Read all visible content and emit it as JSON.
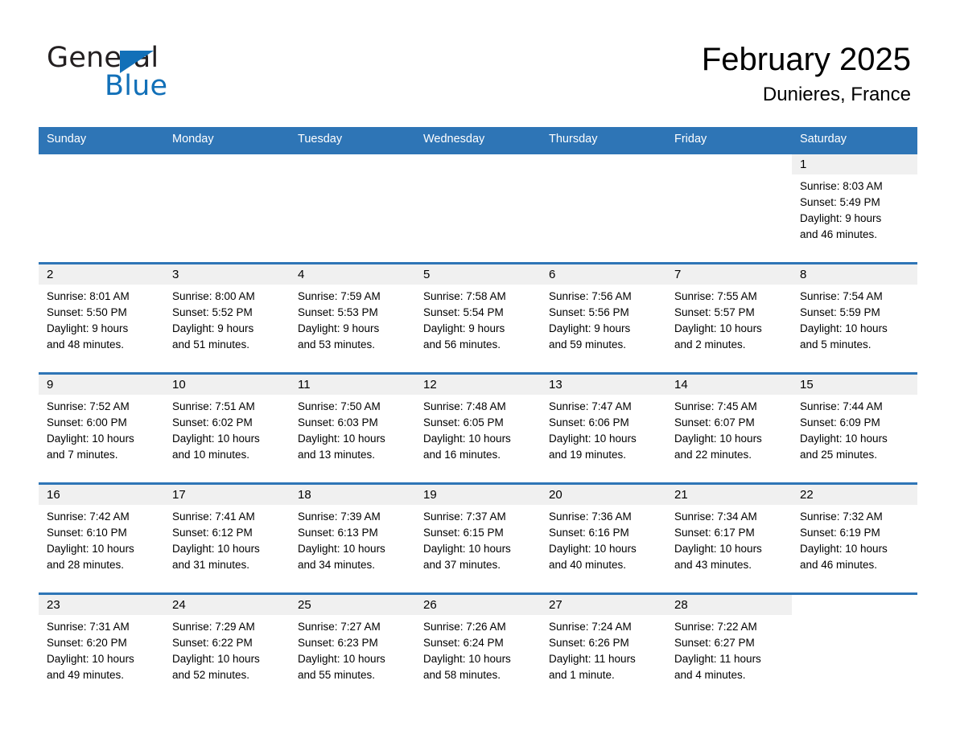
{
  "brand": {
    "logo_text_top": "General",
    "logo_text_bottom": "Blue",
    "logo_accent_color": "#1270b8",
    "triangle_icon": "triangle-icon"
  },
  "header": {
    "title": "February 2025",
    "subtitle": "Dunieres, France"
  },
  "theme": {
    "header_row_color": "#2e75b6",
    "day_band_color": "#f0f0f0",
    "cell_background": "#ffffff",
    "text_color": "#000000"
  },
  "weekdays": [
    "Sunday",
    "Monday",
    "Tuesday",
    "Wednesday",
    "Thursday",
    "Friday",
    "Saturday"
  ],
  "weeks": [
    [
      {
        "day": "",
        "sunrise": "",
        "sunset": "",
        "daylight_line1": "",
        "daylight_line2": ""
      },
      {
        "day": "",
        "sunrise": "",
        "sunset": "",
        "daylight_line1": "",
        "daylight_line2": ""
      },
      {
        "day": "",
        "sunrise": "",
        "sunset": "",
        "daylight_line1": "",
        "daylight_line2": ""
      },
      {
        "day": "",
        "sunrise": "",
        "sunset": "",
        "daylight_line1": "",
        "daylight_line2": ""
      },
      {
        "day": "",
        "sunrise": "",
        "sunset": "",
        "daylight_line1": "",
        "daylight_line2": ""
      },
      {
        "day": "",
        "sunrise": "",
        "sunset": "",
        "daylight_line1": "",
        "daylight_line2": ""
      },
      {
        "day": "1",
        "sunrise": "Sunrise: 8:03 AM",
        "sunset": "Sunset: 5:49 PM",
        "daylight_line1": "Daylight: 9 hours",
        "daylight_line2": "and 46 minutes."
      }
    ],
    [
      {
        "day": "2",
        "sunrise": "Sunrise: 8:01 AM",
        "sunset": "Sunset: 5:50 PM",
        "daylight_line1": "Daylight: 9 hours",
        "daylight_line2": "and 48 minutes."
      },
      {
        "day": "3",
        "sunrise": "Sunrise: 8:00 AM",
        "sunset": "Sunset: 5:52 PM",
        "daylight_line1": "Daylight: 9 hours",
        "daylight_line2": "and 51 minutes."
      },
      {
        "day": "4",
        "sunrise": "Sunrise: 7:59 AM",
        "sunset": "Sunset: 5:53 PM",
        "daylight_line1": "Daylight: 9 hours",
        "daylight_line2": "and 53 minutes."
      },
      {
        "day": "5",
        "sunrise": "Sunrise: 7:58 AM",
        "sunset": "Sunset: 5:54 PM",
        "daylight_line1": "Daylight: 9 hours",
        "daylight_line2": "and 56 minutes."
      },
      {
        "day": "6",
        "sunrise": "Sunrise: 7:56 AM",
        "sunset": "Sunset: 5:56 PM",
        "daylight_line1": "Daylight: 9 hours",
        "daylight_line2": "and 59 minutes."
      },
      {
        "day": "7",
        "sunrise": "Sunrise: 7:55 AM",
        "sunset": "Sunset: 5:57 PM",
        "daylight_line1": "Daylight: 10 hours",
        "daylight_line2": "and 2 minutes."
      },
      {
        "day": "8",
        "sunrise": "Sunrise: 7:54 AM",
        "sunset": "Sunset: 5:59 PM",
        "daylight_line1": "Daylight: 10 hours",
        "daylight_line2": "and 5 minutes."
      }
    ],
    [
      {
        "day": "9",
        "sunrise": "Sunrise: 7:52 AM",
        "sunset": "Sunset: 6:00 PM",
        "daylight_line1": "Daylight: 10 hours",
        "daylight_line2": "and 7 minutes."
      },
      {
        "day": "10",
        "sunrise": "Sunrise: 7:51 AM",
        "sunset": "Sunset: 6:02 PM",
        "daylight_line1": "Daylight: 10 hours",
        "daylight_line2": "and 10 minutes."
      },
      {
        "day": "11",
        "sunrise": "Sunrise: 7:50 AM",
        "sunset": "Sunset: 6:03 PM",
        "daylight_line1": "Daylight: 10 hours",
        "daylight_line2": "and 13 minutes."
      },
      {
        "day": "12",
        "sunrise": "Sunrise: 7:48 AM",
        "sunset": "Sunset: 6:05 PM",
        "daylight_line1": "Daylight: 10 hours",
        "daylight_line2": "and 16 minutes."
      },
      {
        "day": "13",
        "sunrise": "Sunrise: 7:47 AM",
        "sunset": "Sunset: 6:06 PM",
        "daylight_line1": "Daylight: 10 hours",
        "daylight_line2": "and 19 minutes."
      },
      {
        "day": "14",
        "sunrise": "Sunrise: 7:45 AM",
        "sunset": "Sunset: 6:07 PM",
        "daylight_line1": "Daylight: 10 hours",
        "daylight_line2": "and 22 minutes."
      },
      {
        "day": "15",
        "sunrise": "Sunrise: 7:44 AM",
        "sunset": "Sunset: 6:09 PM",
        "daylight_line1": "Daylight: 10 hours",
        "daylight_line2": "and 25 minutes."
      }
    ],
    [
      {
        "day": "16",
        "sunrise": "Sunrise: 7:42 AM",
        "sunset": "Sunset: 6:10 PM",
        "daylight_line1": "Daylight: 10 hours",
        "daylight_line2": "and 28 minutes."
      },
      {
        "day": "17",
        "sunrise": "Sunrise: 7:41 AM",
        "sunset": "Sunset: 6:12 PM",
        "daylight_line1": "Daylight: 10 hours",
        "daylight_line2": "and 31 minutes."
      },
      {
        "day": "18",
        "sunrise": "Sunrise: 7:39 AM",
        "sunset": "Sunset: 6:13 PM",
        "daylight_line1": "Daylight: 10 hours",
        "daylight_line2": "and 34 minutes."
      },
      {
        "day": "19",
        "sunrise": "Sunrise: 7:37 AM",
        "sunset": "Sunset: 6:15 PM",
        "daylight_line1": "Daylight: 10 hours",
        "daylight_line2": "and 37 minutes."
      },
      {
        "day": "20",
        "sunrise": "Sunrise: 7:36 AM",
        "sunset": "Sunset: 6:16 PM",
        "daylight_line1": "Daylight: 10 hours",
        "daylight_line2": "and 40 minutes."
      },
      {
        "day": "21",
        "sunrise": "Sunrise: 7:34 AM",
        "sunset": "Sunset: 6:17 PM",
        "daylight_line1": "Daylight: 10 hours",
        "daylight_line2": "and 43 minutes."
      },
      {
        "day": "22",
        "sunrise": "Sunrise: 7:32 AM",
        "sunset": "Sunset: 6:19 PM",
        "daylight_line1": "Daylight: 10 hours",
        "daylight_line2": "and 46 minutes."
      }
    ],
    [
      {
        "day": "23",
        "sunrise": "Sunrise: 7:31 AM",
        "sunset": "Sunset: 6:20 PM",
        "daylight_line1": "Daylight: 10 hours",
        "daylight_line2": "and 49 minutes."
      },
      {
        "day": "24",
        "sunrise": "Sunrise: 7:29 AM",
        "sunset": "Sunset: 6:22 PM",
        "daylight_line1": "Daylight: 10 hours",
        "daylight_line2": "and 52 minutes."
      },
      {
        "day": "25",
        "sunrise": "Sunrise: 7:27 AM",
        "sunset": "Sunset: 6:23 PM",
        "daylight_line1": "Daylight: 10 hours",
        "daylight_line2": "and 55 minutes."
      },
      {
        "day": "26",
        "sunrise": "Sunrise: 7:26 AM",
        "sunset": "Sunset: 6:24 PM",
        "daylight_line1": "Daylight: 10 hours",
        "daylight_line2": "and 58 minutes."
      },
      {
        "day": "27",
        "sunrise": "Sunrise: 7:24 AM",
        "sunset": "Sunset: 6:26 PM",
        "daylight_line1": "Daylight: 11 hours",
        "daylight_line2": "and 1 minute."
      },
      {
        "day": "28",
        "sunrise": "Sunrise: 7:22 AM",
        "sunset": "Sunset: 6:27 PM",
        "daylight_line1": "Daylight: 11 hours",
        "daylight_line2": "and 4 minutes."
      },
      {
        "day": "",
        "sunrise": "",
        "sunset": "",
        "daylight_line1": "",
        "daylight_line2": ""
      }
    ]
  ]
}
